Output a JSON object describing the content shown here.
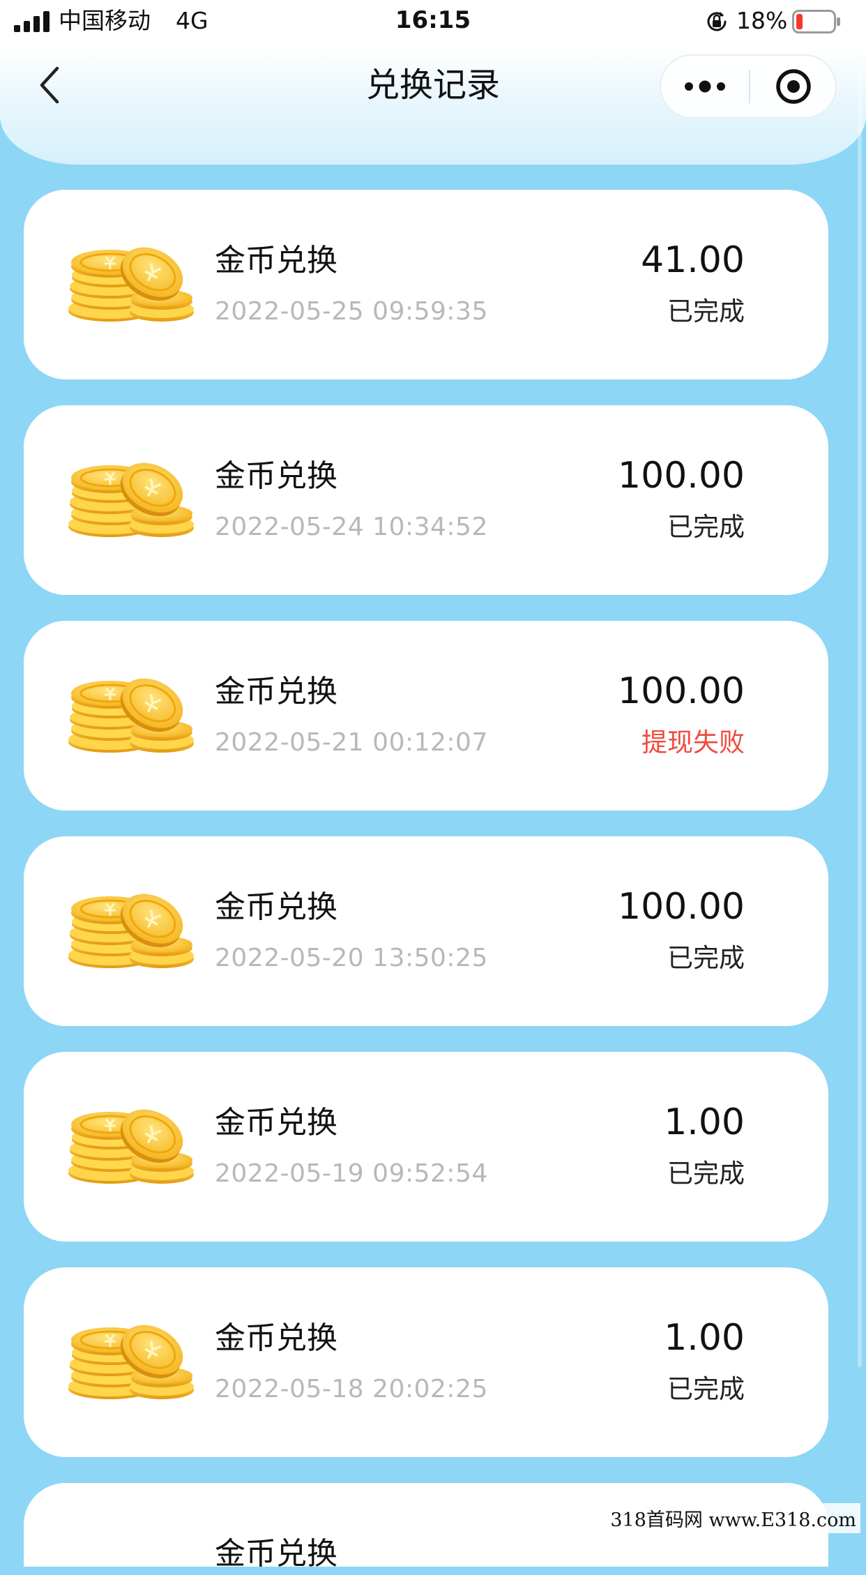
{
  "status_bar": {
    "carrier": "中国移动",
    "network": "4G",
    "time": "16:15",
    "battery_percent": "18%",
    "battery_level": 0.18
  },
  "nav": {
    "title": "兑换记录",
    "icons": {
      "back": "chevron-left-icon",
      "more": "more-dots-icon",
      "close": "target-close-icon"
    }
  },
  "colors": {
    "page_bg": "#8dd6f5",
    "card_bg": "#ffffff",
    "failed_status": "#f04b40",
    "muted_text": "#b8b8b8",
    "coin_gold": "#f5b820"
  },
  "records": [
    {
      "title": "金币兑换",
      "time": "2022-05-25 09:59:35",
      "amount": "41.00",
      "status": "已完成"
    },
    {
      "title": "金币兑换",
      "time": "2022-05-24 10:34:52",
      "amount": "100.00",
      "status": "已完成"
    },
    {
      "title": "金币兑换",
      "time": "2022-05-21 00:12:07",
      "amount": "100.00",
      "status": "提现失败"
    },
    {
      "title": "金币兑换",
      "time": "2022-05-20 13:50:25",
      "amount": "100.00",
      "status": "已完成"
    },
    {
      "title": "金币兑换",
      "time": "2022-05-19 09:52:54",
      "amount": "1.00",
      "status": "已完成"
    },
    {
      "title": "金币兑换",
      "time": "2022-05-18 20:02:25",
      "amount": "1.00",
      "status": "已完成"
    },
    {
      "title": "金币兑换",
      "time": "",
      "amount": "",
      "status": ""
    }
  ],
  "watermark": "318首码网 www.E318.com"
}
